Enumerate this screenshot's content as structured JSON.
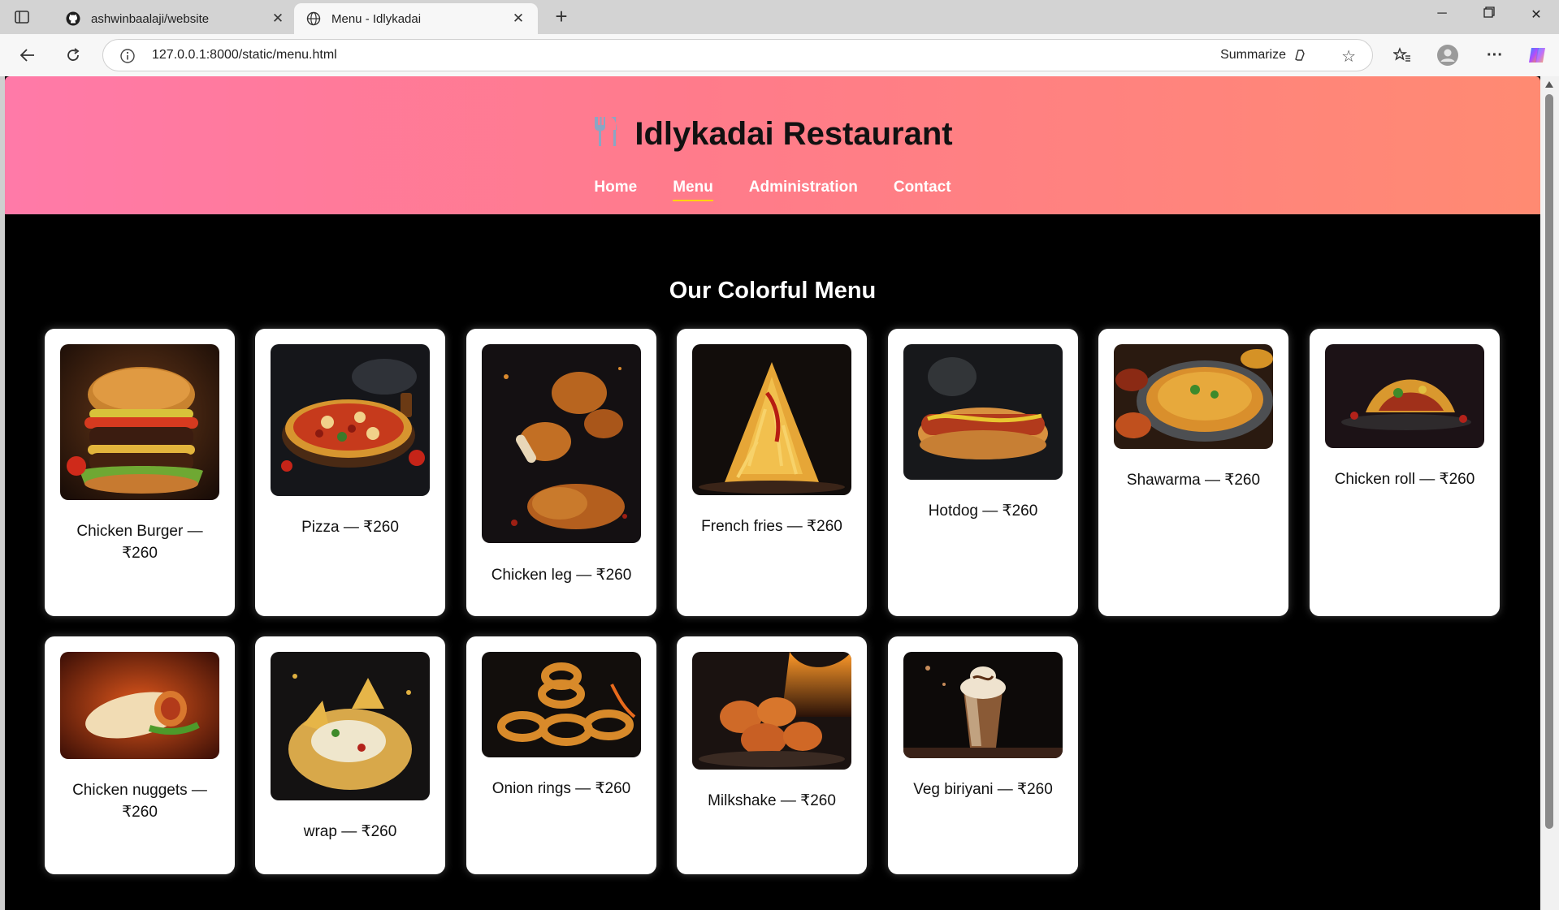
{
  "browser": {
    "tabs": [
      {
        "title": "ashwinbaalaji/website",
        "icon": "github-icon"
      },
      {
        "title": "Menu - Idlykadai",
        "icon": "globe-icon"
      }
    ],
    "address": "127.0.0.1:8000/static/menu.html",
    "summarize_label": "Summarize"
  },
  "site": {
    "brand": "Idlykadai Restaurant",
    "nav": [
      "Home",
      "Menu",
      "Administration",
      "Contact"
    ],
    "active_nav": "Menu",
    "menu_heading": "Our Colorful Menu"
  },
  "menu": [
    {
      "name": "Chicken Burger — ₹260",
      "caption_lines": [
        "Chicken Burger —",
        "₹260"
      ],
      "scene": "burger"
    },
    {
      "name": "Pizza — ₹260",
      "caption_lines": [
        "Pizza — ₹260"
      ],
      "scene": "pizza"
    },
    {
      "name": "Chicken leg — ₹260",
      "caption_lines": [
        "Chicken leg — ₹260"
      ],
      "scene": "chicken"
    },
    {
      "name": "French fries — ₹260",
      "caption_lines": [
        "French fries — ₹260"
      ],
      "scene": "fries"
    },
    {
      "name": "Hotdog — ₹260",
      "caption_lines": [
        "Hotdog — ₹260"
      ],
      "scene": "hotdog"
    },
    {
      "name": "Shawarma — ₹260",
      "caption_lines": [
        "Shawarma — ₹260"
      ],
      "scene": "biryani"
    },
    {
      "name": "Chicken roll — ₹260",
      "caption_lines": [
        "Chicken roll — ₹260"
      ],
      "scene": "taco"
    },
    {
      "name": "Chicken nuggets — ₹260",
      "caption_lines": [
        "Chicken nuggets —",
        "₹260"
      ],
      "scene": "wrap"
    },
    {
      "name": "wrap — ₹260",
      "caption_lines": [
        "wrap — ₹260"
      ],
      "scene": "nachos"
    },
    {
      "name": "Onion rings — ₹260",
      "caption_lines": [
        "Onion rings — ₹260"
      ],
      "scene": "rings"
    },
    {
      "name": "Milkshake — ₹260",
      "caption_lines": [
        "Milkshake — ₹260"
      ],
      "scene": "nuggets"
    },
    {
      "name": "Veg biriyani — ₹260",
      "caption_lines": [
        "Veg biriyani — ₹260"
      ],
      "scene": "milkshake"
    }
  ]
}
